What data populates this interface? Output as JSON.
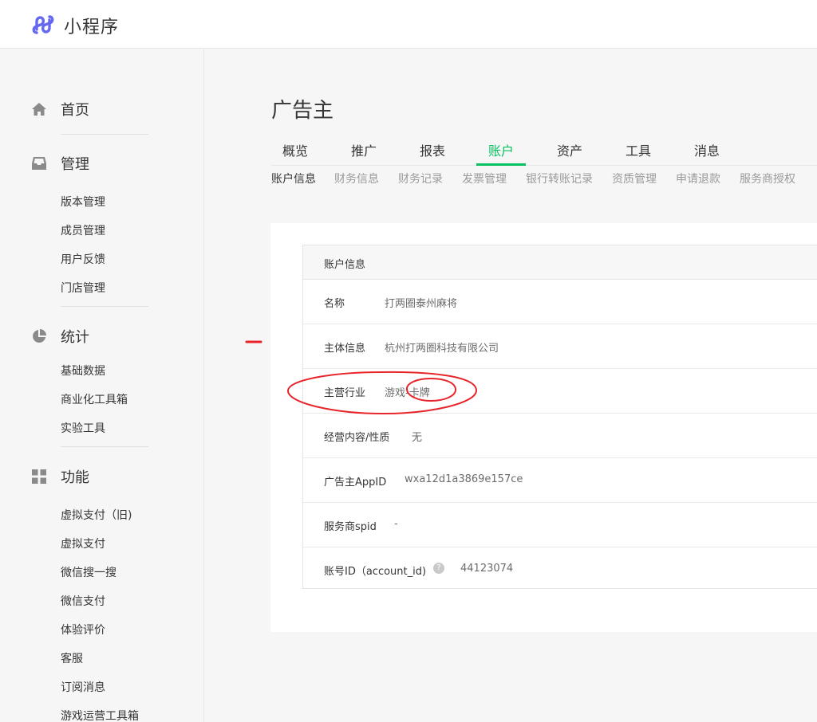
{
  "app": {
    "title": "小程序",
    "logo_icon": "miniprogram-logo-icon"
  },
  "sidebar": {
    "sections": [
      {
        "label": "首页",
        "icon": "home-icon"
      },
      {
        "label": "管理",
        "icon": "inbox-icon",
        "items": [
          "版本管理",
          "成员管理",
          "用户反馈",
          "门店管理"
        ]
      },
      {
        "label": "统计",
        "icon": "pie-chart-icon",
        "items": [
          "基础数据",
          "商业化工具箱",
          "实验工具"
        ]
      },
      {
        "label": "功能",
        "icon": "grid-icon",
        "items": [
          "虚拟支付（旧)",
          "虚拟支付",
          "微信搜一搜",
          "微信支付",
          "体验评价",
          "客服",
          "订阅消息",
          "游戏运营工具箱"
        ]
      }
    ]
  },
  "page": {
    "title": "广告主"
  },
  "tabs": [
    "概览",
    "推广",
    "报表",
    "账户",
    "资产",
    "工具",
    "消息"
  ],
  "active_tab": "账户",
  "subtabs": [
    "账户信息",
    "财务信息",
    "财务记录",
    "发票管理",
    "银行转账记录",
    "资质管理",
    "申请退款",
    "服务商授权"
  ],
  "active_subtab": "账户信息",
  "account": {
    "header": "账户信息",
    "rows": [
      {
        "label": "名称",
        "value": "打两圈泰州麻将"
      },
      {
        "label": "主体信息",
        "value": "杭州打两圈科技有限公司"
      },
      {
        "label": "主营行业",
        "value": "游戏-卡牌"
      },
      {
        "label": "经营内容/性质",
        "value": "无"
      },
      {
        "label": "广告主AppID",
        "value": "wxa12d1a3869e157ce"
      },
      {
        "label": "服务商spid",
        "value": "-"
      },
      {
        "label": "账号ID（account_id)",
        "value": "44123074",
        "help": "?"
      }
    ]
  },
  "colors": {
    "accent": "#07c160",
    "logo": "#6467f0",
    "annotation": "#e8242b"
  }
}
